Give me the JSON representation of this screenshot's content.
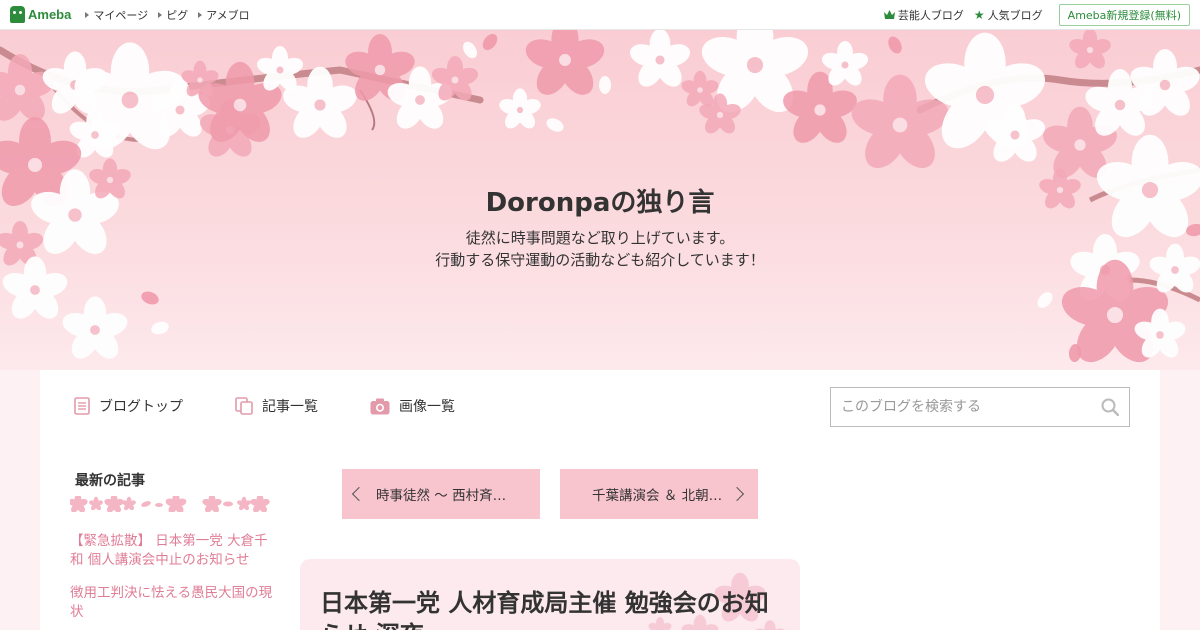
{
  "topbar": {
    "logo": "Ameba",
    "nav": [
      "マイページ",
      "ピグ",
      "アメブロ"
    ],
    "celebrity_blog": "芸能人ブログ",
    "popular_blog": "人気ブログ",
    "register": "Ameba新規登録(無料)"
  },
  "header": {
    "title": "Doronpaの独り言",
    "description_line1": "徒然に時事問題など取り上げています。",
    "description_line2": "行動する保守運動の活動なども紹介しています！"
  },
  "menu": {
    "blog_top": "ブログトップ",
    "entries": "記事一覧",
    "images": "画像一覧"
  },
  "search": {
    "placeholder": "このブログを検索する"
  },
  "sidebar": {
    "heading": "最新の記事",
    "links": [
      "【緊急拡散】 日本第一党 大倉千和 個人講演会中止のお知らせ",
      "徴用工判決に怯える愚民大国の現状"
    ]
  },
  "pager": {
    "prev": "時事徒然 ～ 西村斉…",
    "next": "千葉講演会 ＆ 北朝…"
  },
  "article": {
    "title": "日本第一党 人材育成局主催 勉強会のお知らせ 深夜"
  },
  "colors": {
    "accent_green": "#2d8c3c",
    "header_pink": "#f9cdd3",
    "link_pink": "#e07d96",
    "pager_pink": "#f8c5cf"
  },
  "icons": [
    "crown-icon",
    "star-icon",
    "document-icon",
    "copy-icon",
    "camera-icon",
    "search-icon",
    "chevron-left-icon",
    "chevron-right-icon",
    "blossom-divider-icon"
  ]
}
